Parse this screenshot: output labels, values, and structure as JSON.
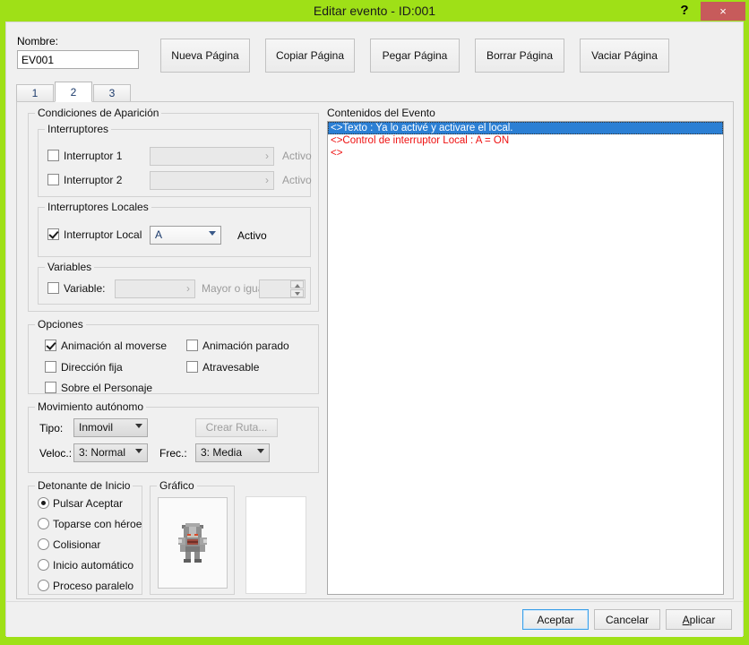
{
  "window": {
    "title": "Editar evento - ID:001",
    "help_label": "?",
    "close_label": "×",
    "titlebar_color": "#9fe017",
    "close_color": "#c75b5b"
  },
  "top": {
    "nombre_label": "Nombre:",
    "nombre_value": "EV001",
    "page_buttons": [
      "Nueva Página",
      "Copiar Página",
      "Pegar Página",
      "Borrar Página",
      "Vaciar Página"
    ]
  },
  "tabs": {
    "items": [
      "1",
      "2",
      "3"
    ],
    "selected_index": 1
  },
  "conditions": {
    "caption": "Condiciones de Aparición",
    "switches": {
      "caption": "Interruptores",
      "rows": [
        {
          "label": "Interruptor 1",
          "checked": false,
          "field_value": "",
          "arrow": "›",
          "state": "Activo"
        },
        {
          "label": "Interruptor 2",
          "checked": false,
          "field_value": "",
          "arrow": "›",
          "state": "Activo"
        }
      ]
    },
    "local_switches": {
      "caption": "Interruptores Locales",
      "label": "Interruptor Local",
      "checked": true,
      "selected": "A",
      "state": "Activo"
    },
    "variables": {
      "caption": "Variables",
      "label": "Variable:",
      "checked": false,
      "field_value": "",
      "arrow": "›",
      "comparison": "Mayor o igual",
      "amount": ""
    }
  },
  "options": {
    "caption": "Opciones",
    "items": [
      {
        "label": "Animación al moverse",
        "checked": true
      },
      {
        "label": "Animación parado",
        "checked": false
      },
      {
        "label": "Dirección fija",
        "checked": false
      },
      {
        "label": "Atravesable",
        "checked": false
      },
      {
        "label": "Sobre el Personaje",
        "checked": false
      }
    ]
  },
  "movement": {
    "caption": "Movimiento autónomo",
    "tipo_label": "Tipo:",
    "tipo_value": "Inmovil",
    "route_button": "Crear Ruta...",
    "veloc_label": "Veloc.:",
    "veloc_value": "3: Normal",
    "frec_label": "Frec.:",
    "frec_value": "3: Media"
  },
  "trigger": {
    "caption": "Detonante de Inicio",
    "items": [
      {
        "label": "Pulsar Aceptar",
        "selected": true
      },
      {
        "label": "Toparse con héroe",
        "selected": false
      },
      {
        "label": "Colisionar",
        "selected": false
      },
      {
        "label": "Inicio automático",
        "selected": false
      },
      {
        "label": "Proceso paralelo",
        "selected": false
      }
    ]
  },
  "graphic": {
    "caption": "Gráfico",
    "sprite_name": "armored-knight-sprite"
  },
  "event_contents": {
    "caption": "Contenidos del Evento",
    "lines": [
      {
        "text": "<>Texto : Ya lo activé y activare el local.",
        "selected": true
      },
      {
        "text": "<>Control de interruptor Local : A = ON",
        "selected": false
      },
      {
        "text": "<>",
        "selected": false
      }
    ],
    "selection_color": "#2b7fd4",
    "text_color": "#ee1111"
  },
  "footer": {
    "accept": "Aceptar",
    "cancel": "Cancelar",
    "apply": "Aplicar",
    "apply_mnemonic": "A",
    "apply_rest": "plicar"
  }
}
